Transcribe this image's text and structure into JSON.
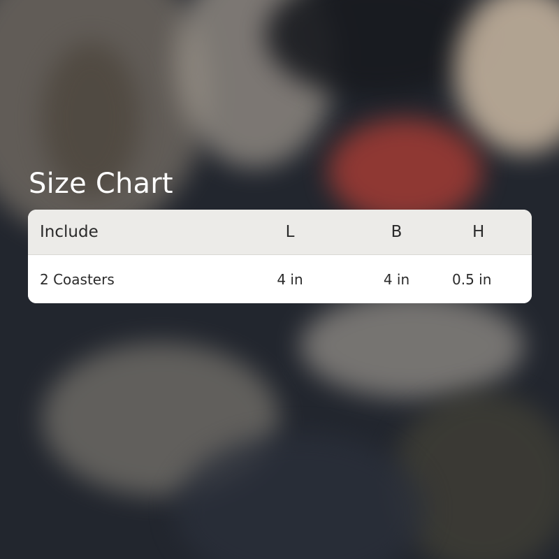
{
  "title": "Size Chart",
  "table": {
    "headers": [
      "Include",
      "L",
      "B",
      "H"
    ],
    "rows": [
      [
        "2 Coasters",
        "4 in",
        "4 in",
        "0.5 in"
      ]
    ]
  },
  "colors": {
    "background": "#22262e",
    "header_bg": "#ecebe8",
    "row_bg": "#ffffff",
    "text": "#2a2a2a",
    "title": "#ffffff"
  }
}
